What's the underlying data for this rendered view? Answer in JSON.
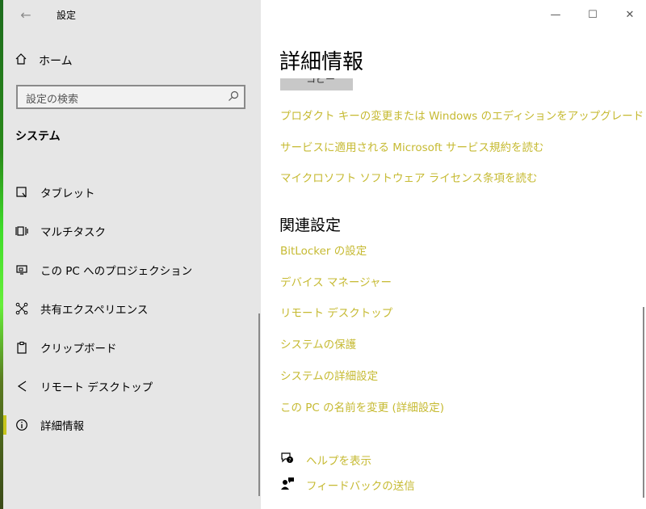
{
  "window": {
    "title": "設定"
  },
  "sidebar": {
    "home_label": "ホーム",
    "search_placeholder": "設定の検索",
    "section_title": "システム",
    "items": [
      {
        "label": "タブレット",
        "icon": "tablet-icon"
      },
      {
        "label": "マルチタスク",
        "icon": "multitask-icon"
      },
      {
        "label": "この PC へのプロジェクション",
        "icon": "projection-icon"
      },
      {
        "label": "共有エクスペリエンス",
        "icon": "shared-experience-icon"
      },
      {
        "label": "クリップボード",
        "icon": "clipboard-icon"
      },
      {
        "label": "リモート デスクトップ",
        "icon": "remote-desktop-icon"
      },
      {
        "label": "詳細情報",
        "icon": "info-icon",
        "selected": true
      }
    ]
  },
  "main": {
    "heading": "詳細情報",
    "partial_button_label": "コピー",
    "links": [
      "プロダクト キーの変更または Windows のエディションをアップグレード",
      "サービスに適用される Microsoft サービス規約を読む",
      "マイクロソフト ソフトウェア ライセンス条項を読む"
    ],
    "related_heading": "関連設定",
    "related_links": [
      "BitLocker の設定",
      "デバイス マネージャー",
      "リモート デスクトップ",
      "システムの保護",
      "システムの詳細設定",
      "この PC の名前を変更 (詳細設定)"
    ],
    "help_links": [
      {
        "label": "ヘルプを表示",
        "icon": "help-chat-icon"
      },
      {
        "label": "フィードバックの送信",
        "icon": "feedback-icon"
      }
    ]
  },
  "colors": {
    "accent": "#c6ba32",
    "sidebar_bg": "#e6e6e6"
  }
}
